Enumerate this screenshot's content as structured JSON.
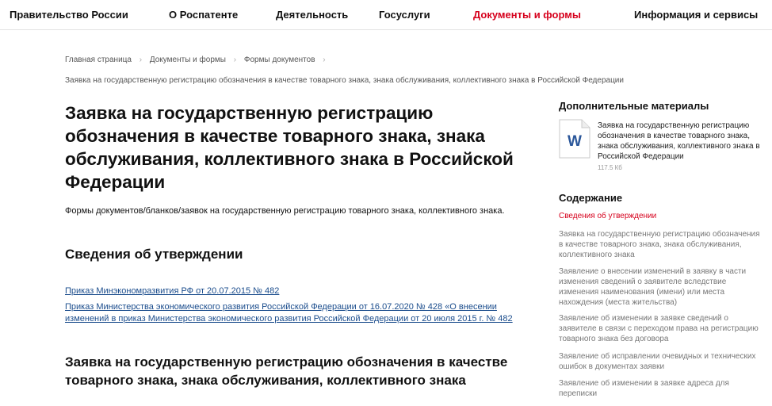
{
  "nav": {
    "items": [
      {
        "label": "Правительство России",
        "active": false
      },
      {
        "label": "О Роспатенте",
        "active": false
      },
      {
        "label": "Деятельность",
        "active": false
      },
      {
        "label": "Госуслуги",
        "active": false
      },
      {
        "label": "Документы и формы",
        "active": true
      },
      {
        "label": "Информация и сервисы",
        "active": false
      }
    ]
  },
  "breadcrumb": {
    "items": [
      "Главная страница",
      "Документы и формы",
      "Формы документов"
    ],
    "separator": "›",
    "current": "Заявка на государственную регистрацию обозначения в качестве товарного знака, знака обслуживания, коллективного знака в Российской Федерации"
  },
  "main": {
    "title": "Заявка на государственную регистрацию обозначения в качестве товарного знака, знака обслуживания, коллективного знака в Российской Федерации",
    "lead": "Формы документов/бланков/заявок на государственную регистрацию товарного знака, коллективного знака.",
    "approval_heading": "Сведения об утверждении",
    "links": [
      "Приказ Минэкономразвития РФ от 20.07.2015 № 482",
      "Приказ Министерства экономического развития Российской Федерации от 16.07.2020 № 428 «О внесении изменений в приказ Министерства экономического развития Российской Федерации от 20 июля 2015 г. № 482"
    ],
    "section_heading": "Заявка на государственную регистрацию обозначения в качестве товарного знака, знака обслуживания, коллективного знака"
  },
  "sidebar": {
    "extra_title": "Дополнительные материалы",
    "file": {
      "icon": "word-document-icon",
      "letter": "W",
      "name": "Заявка на государственную регистрацию обозначения в качестве товарного знака, знака обслуживания, коллективного знака в Российской Федерации",
      "size": "117.5 Кб"
    },
    "toc_title": "Содержание",
    "toc": [
      {
        "label": "Сведения об утверждении",
        "active": true
      },
      {
        "label": "Заявка на государственную регистрацию обозначения в качестве товарного знака, знака обслуживания, коллективного знака",
        "active": false
      },
      {
        "label": "Заявление о внесении изменений в заявку в части изменения сведений о заявителе вследствие изменения наименования (имени) или места нахождения (места жительства)",
        "active": false
      },
      {
        "label": "Заявление об изменении в заявке сведений о заявителе в связи с переходом права на регистрацию товарного знака без договора",
        "active": false
      },
      {
        "label": "Заявление об исправлении очевидных и технических ошибок в документах заявки",
        "active": false
      },
      {
        "label": "Заявление об изменении в заявке адреса для переписки",
        "active": false
      }
    ]
  },
  "colors": {
    "accent": "#d6001c",
    "link": "#1a4c8c",
    "word_blue": "#2b579a"
  }
}
